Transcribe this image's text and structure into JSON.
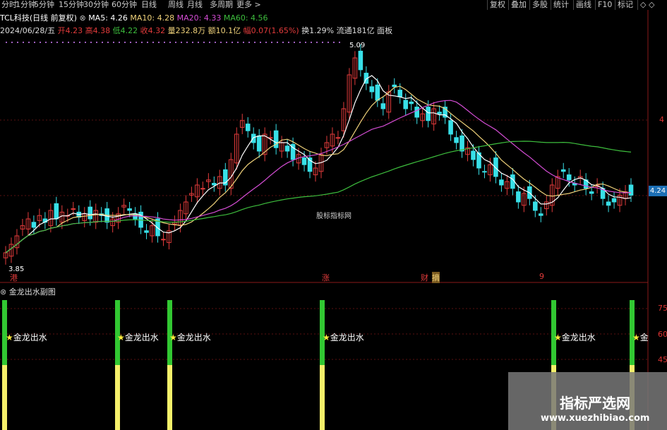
{
  "topbar": {
    "periods": [
      "分时",
      "1分钟",
      "5分钟",
      "15分钟",
      "30分钟",
      "60分钟",
      "日线",
      "周线",
      "月线",
      "多周期",
      "更多 >"
    ],
    "tools": [
      "复权",
      "叠加",
      "多股",
      "统计",
      "画线",
      "F10",
      "标记",
      "◇ ◇"
    ]
  },
  "header": {
    "stock": "TCL科技(日线 前复权)",
    "ma5": "MA5: 4.26",
    "ma10": "MA10: 4.28",
    "ma20": "MA20: 4.33",
    "ma60": "MA60: 4.56",
    "date": "2024/06/28/五",
    "open": "开4.23",
    "high": "高4.38",
    "low": "低4.22",
    "close": "收4.32",
    "volume": "量232.8万",
    "amount": "额10.1亿",
    "change": "幅0.07(1.65%)",
    "turnover": "换1.29%",
    "float_cap": "流通181亿",
    "panel": "面板"
  },
  "chart_labels": {
    "high_mark": "5.09",
    "low_mark": "3.85",
    "current_price": "4.24",
    "axis_top": "4",
    "events": [
      "港",
      "涨",
      "财",
      "摘",
      "9"
    ],
    "watermark": "股标指标网"
  },
  "indicator": {
    "title": "金龙出水副图",
    "signal_label": "金龙出水",
    "signal_label_short": "金",
    "axis": [
      "75",
      "60",
      "45"
    ]
  },
  "overlay": {
    "site_name": "指标严选网",
    "site_url": "www.xuezhibiao.com"
  },
  "colors": {
    "up": "#e23b3b",
    "down": "#38e0e8",
    "ma5": "#ffffff",
    "ma10": "#f0d27a",
    "ma20": "#d44dd4",
    "ma60": "#3dbd3d",
    "signal_green": "#32c832",
    "signal_yellow": "#f5f06a"
  },
  "chart_data": {
    "type": "candlestick",
    "price_range": [
      3.85,
      5.09
    ],
    "closes": [
      3.9,
      3.95,
      4.0,
      4.06,
      4.1,
      4.05,
      4.12,
      4.08,
      4.15,
      4.1,
      4.14,
      4.12,
      4.16,
      4.11,
      4.13,
      4.1,
      4.15,
      4.12,
      4.08,
      4.1,
      4.13,
      4.18,
      4.15,
      4.1,
      4.05,
      4.02,
      4.06,
      4.0,
      3.98,
      4.03,
      4.08,
      4.15,
      4.2,
      4.25,
      4.3,
      4.28,
      4.33,
      4.3,
      4.35,
      4.3,
      4.45,
      4.6,
      4.68,
      4.62,
      4.55,
      4.5,
      4.6,
      4.58,
      4.52,
      4.55,
      4.5,
      4.45,
      4.48,
      4.42,
      4.38,
      4.4,
      4.48,
      4.55,
      4.6,
      4.58,
      4.75,
      4.95,
      5.05,
      4.98,
      4.9,
      4.85,
      4.8,
      4.75,
      4.85,
      4.88,
      4.82,
      4.75,
      4.78,
      4.7,
      4.72,
      4.68,
      4.75,
      4.72,
      4.7,
      4.6,
      4.55,
      4.5,
      4.52,
      4.45,
      4.4,
      4.38,
      4.42,
      4.35,
      4.3,
      4.32,
      4.28,
      4.2,
      4.25,
      4.22,
      4.15,
      4.12,
      4.2,
      4.3,
      4.35,
      4.38,
      4.33,
      4.3,
      4.35,
      4.28,
      4.25,
      4.3,
      4.22,
      4.18,
      4.2,
      4.24,
      4.26,
      4.24
    ]
  }
}
